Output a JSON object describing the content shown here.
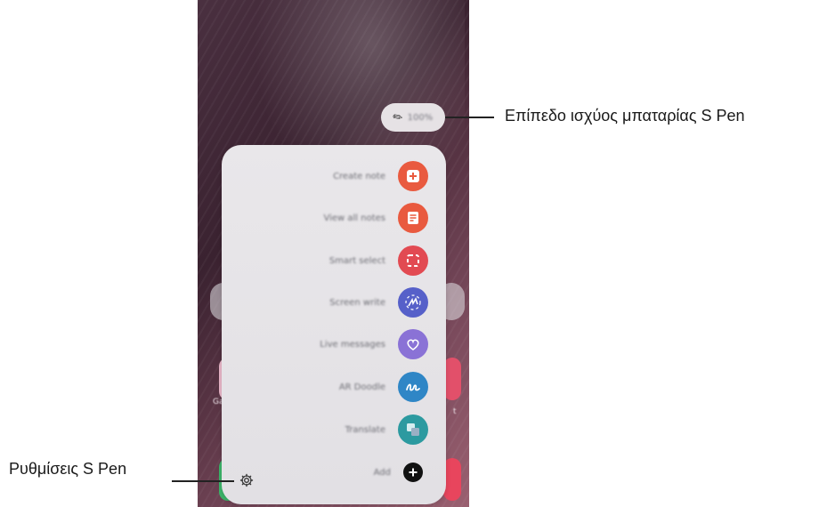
{
  "battery": {
    "level_text": "100%"
  },
  "background_apps": {
    "left_label": "Ga",
    "right_label": "t"
  },
  "menu": {
    "items": [
      {
        "label": "Create note",
        "icon": "create-note-icon",
        "color": "#e95a3f"
      },
      {
        "label": "View all notes",
        "icon": "view-notes-icon",
        "color": "#e95a3f"
      },
      {
        "label": "Smart select",
        "icon": "smart-select-icon",
        "color": "#e24a52"
      },
      {
        "label": "Screen write",
        "icon": "screen-write-icon",
        "color": "#5660c9"
      },
      {
        "label": "Live messages",
        "icon": "live-messages-icon",
        "color": "#8a72d6"
      },
      {
        "label": "AR Doodle",
        "icon": "ar-doodle-icon",
        "color": "#2f86c6"
      },
      {
        "label": "Translate",
        "icon": "translate-icon",
        "color": "#2c9aa0"
      },
      {
        "label": "Add",
        "icon": "add-icon",
        "color": "#111111"
      }
    ],
    "settings_icon": "gear-icon"
  },
  "callouts": {
    "battery": "Επίπεδο ισχύος μπαταρίας S Pen",
    "settings": "Ρυθμίσεις S Pen"
  }
}
